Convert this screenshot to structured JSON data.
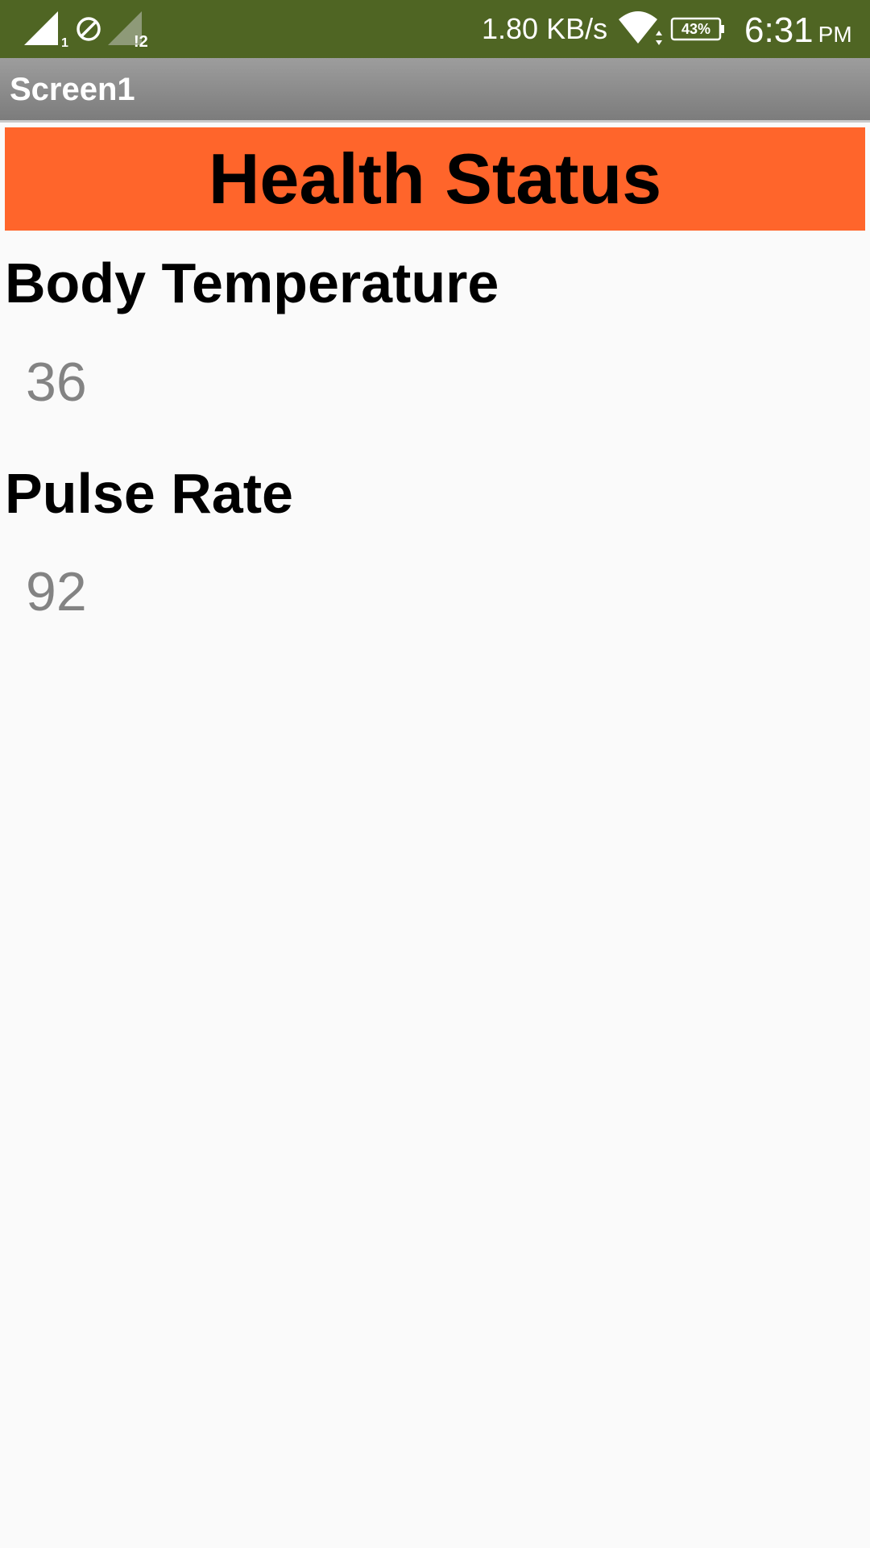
{
  "status_bar": {
    "sim1_label": "1",
    "sim2_label": "!2",
    "network_speed": "1.80 KB/s",
    "battery_percent": "43%",
    "time": "6:31",
    "ampm": "PM",
    "bg_color": "#4f6523"
  },
  "app_bar": {
    "title": "Screen1"
  },
  "header": {
    "title": "Health Status",
    "bg_color": "#ff652b"
  },
  "readings": [
    {
      "label": "Body Temperature",
      "value": "36"
    },
    {
      "label": "Pulse Rate",
      "value": "92"
    }
  ]
}
